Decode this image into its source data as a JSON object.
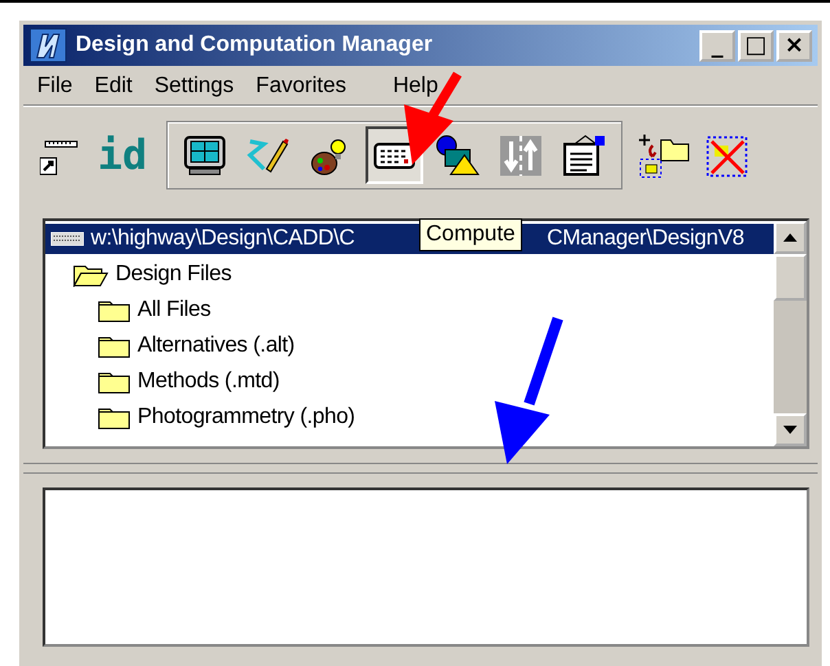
{
  "window": {
    "title": "Design and Computation Manager",
    "controls": [
      "_",
      "□",
      "×"
    ]
  },
  "menu": [
    "File",
    "Edit",
    "Settings",
    "Favorites",
    "Help"
  ],
  "toolbar": {
    "label": "id",
    "buttons": [
      {
        "selected": false
      },
      {
        "selected": false
      },
      {
        "selected": false
      },
      {
        "selected": true
      },
      {
        "selected": false
      },
      {
        "selected": false
      },
      {
        "selected": false
      }
    ]
  },
  "tree": {
    "root": {
      "path_start": "w:\\highway\\Design\\CADD\\C",
      "path_end": "CManager\\DesignV8",
      "selected": true,
      "children": [
        {
          "label": "Design Files",
          "expanded": true,
          "children": [
            {
              "label": "All Files"
            },
            {
              "label": "Alternatives (.alt)"
            },
            {
              "label": "Methods (.mtd)"
            },
            {
              "label": "Photogrammetry (.pho)"
            }
          ]
        }
      ]
    }
  },
  "tooltip": "Compute"
}
